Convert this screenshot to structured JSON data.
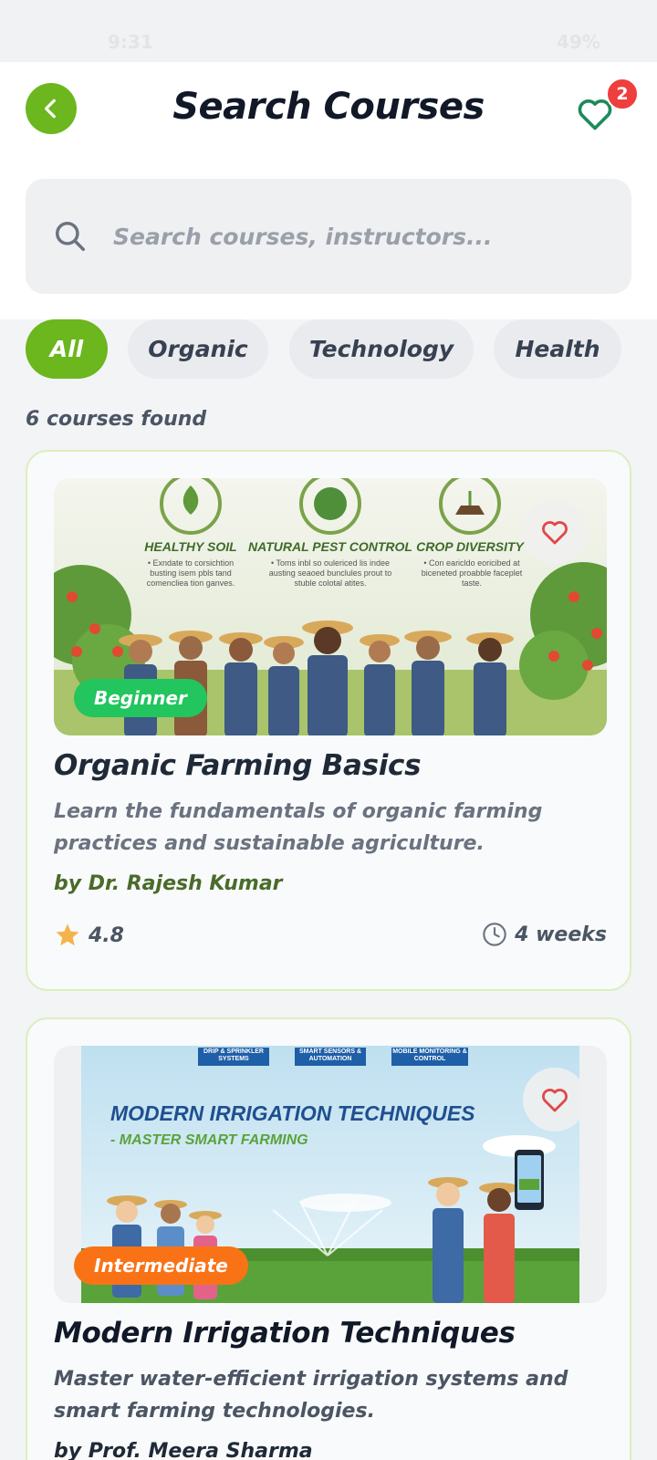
{
  "status_bar": {
    "time": "9:31",
    "battery": "49%"
  },
  "header": {
    "title": "Search Courses",
    "favorites_count": "2"
  },
  "search": {
    "placeholder": "Search courses, instructors..."
  },
  "filters": [
    {
      "label": "All",
      "active": true
    },
    {
      "label": "Organic",
      "active": false
    },
    {
      "label": "Technology",
      "active": false
    },
    {
      "label": "Health",
      "active": false
    }
  ],
  "results": {
    "count_text": "6 courses found"
  },
  "courses": [
    {
      "title": "Organic Farming Basics",
      "description": "Learn the fundamentals of organic farming practices and sustainable agriculture.",
      "instructor": "by Dr. Rajesh Kumar",
      "rating": "4.8",
      "duration": "4 weeks",
      "level": "Beginner",
      "level_color": "#22c55e",
      "image": {
        "panels": [
          {
            "heading": "HEALTHY SOIL",
            "text": "• Exndate to corsichtion busting isem pbls tand comencliea tion ganves."
          },
          {
            "heading": "NATURAL PEST CONTROL",
            "text": "• Toms inbl so oulericed lis indee austing seaoed bunclules prout to stuble colotal atites."
          },
          {
            "heading": "CROP DIVERSITY",
            "text": "• Con earicldo eoricibed at biceneted proabble faceplet taste."
          }
        ]
      }
    },
    {
      "title": "Modern Irrigation Techniques",
      "description": "Master water-efficient irrigation systems and smart farming technologies.",
      "instructor": "by Prof. Meera Sharma",
      "level": "Intermediate",
      "level_color": "#f97316",
      "image": {
        "tags": [
          "DRIP & SPRINKLER SYSTEMS",
          "SMART SENSORS & AUTOMATION",
          "MOBILE MONITORING & CONTROL"
        ],
        "headline": "MODERN IRRIGATION TECHNIQUES",
        "subheadline": "- MASTER SMART FARMING"
      }
    }
  ],
  "colors": {
    "primary": "#6cb61e",
    "badge": "#ef3e3e",
    "card_border": "#dcefbf"
  }
}
